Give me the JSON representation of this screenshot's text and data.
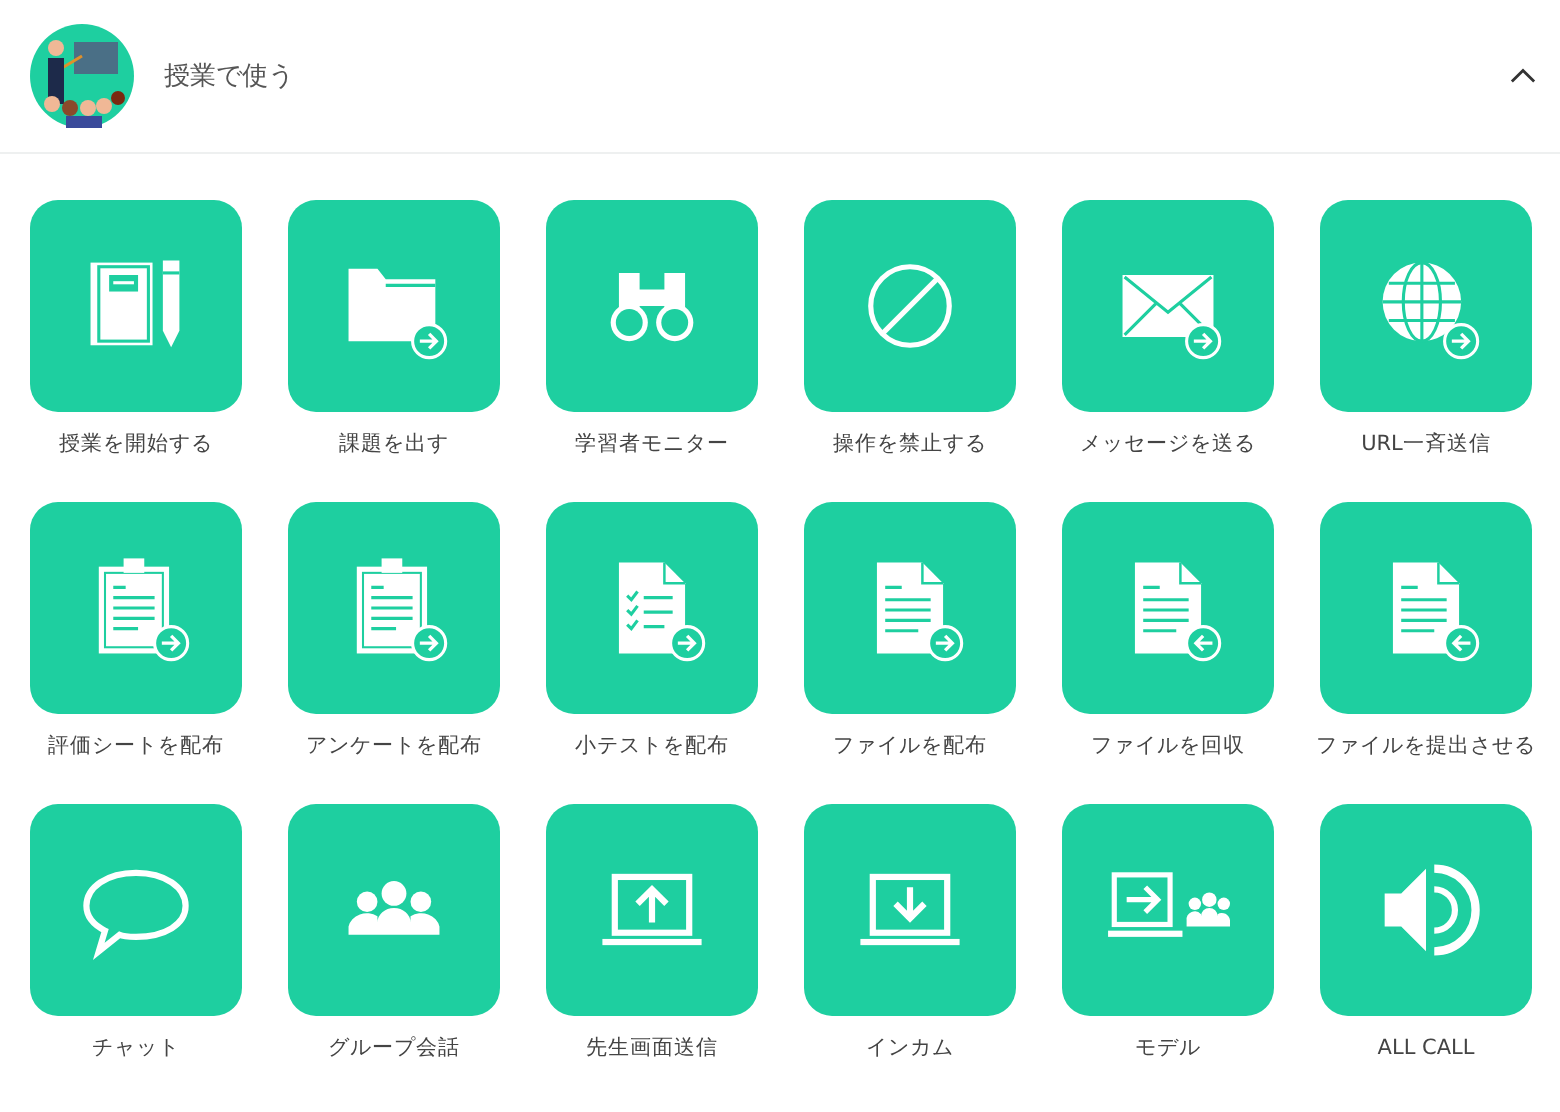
{
  "section": {
    "title": "授業で使う",
    "expanded": true
  },
  "tiles": [
    {
      "label": "授業を開始する",
      "kind": "notebook"
    },
    {
      "label": "課題を出す",
      "kind": "folder"
    },
    {
      "label": "学習者モニター",
      "kind": "binoculars"
    },
    {
      "label": "操作を禁止する",
      "kind": "prohibit"
    },
    {
      "label": "メッセージを送る",
      "kind": "envelope"
    },
    {
      "label": "URL一斉送信",
      "kind": "globe"
    },
    {
      "label": "評価シートを配布",
      "kind": "clipboard"
    },
    {
      "label": "アンケートを配布",
      "kind": "clipboard"
    },
    {
      "label": "小テストを配布",
      "kind": "checklist"
    },
    {
      "label": "ファイルを配布",
      "kind": "document-send"
    },
    {
      "label": "ファイルを回収",
      "kind": "document-collect"
    },
    {
      "label": "ファイルを提出させる",
      "kind": "document-collect"
    },
    {
      "label": "チャット",
      "kind": "chat"
    },
    {
      "label": "グループ会話",
      "kind": "group"
    },
    {
      "label": "先生画面送信",
      "kind": "screen-up"
    },
    {
      "label": "インカム",
      "kind": "screen-down"
    },
    {
      "label": "モデル",
      "kind": "model"
    },
    {
      "label": "ALL CALL",
      "kind": "speaker"
    }
  ]
}
